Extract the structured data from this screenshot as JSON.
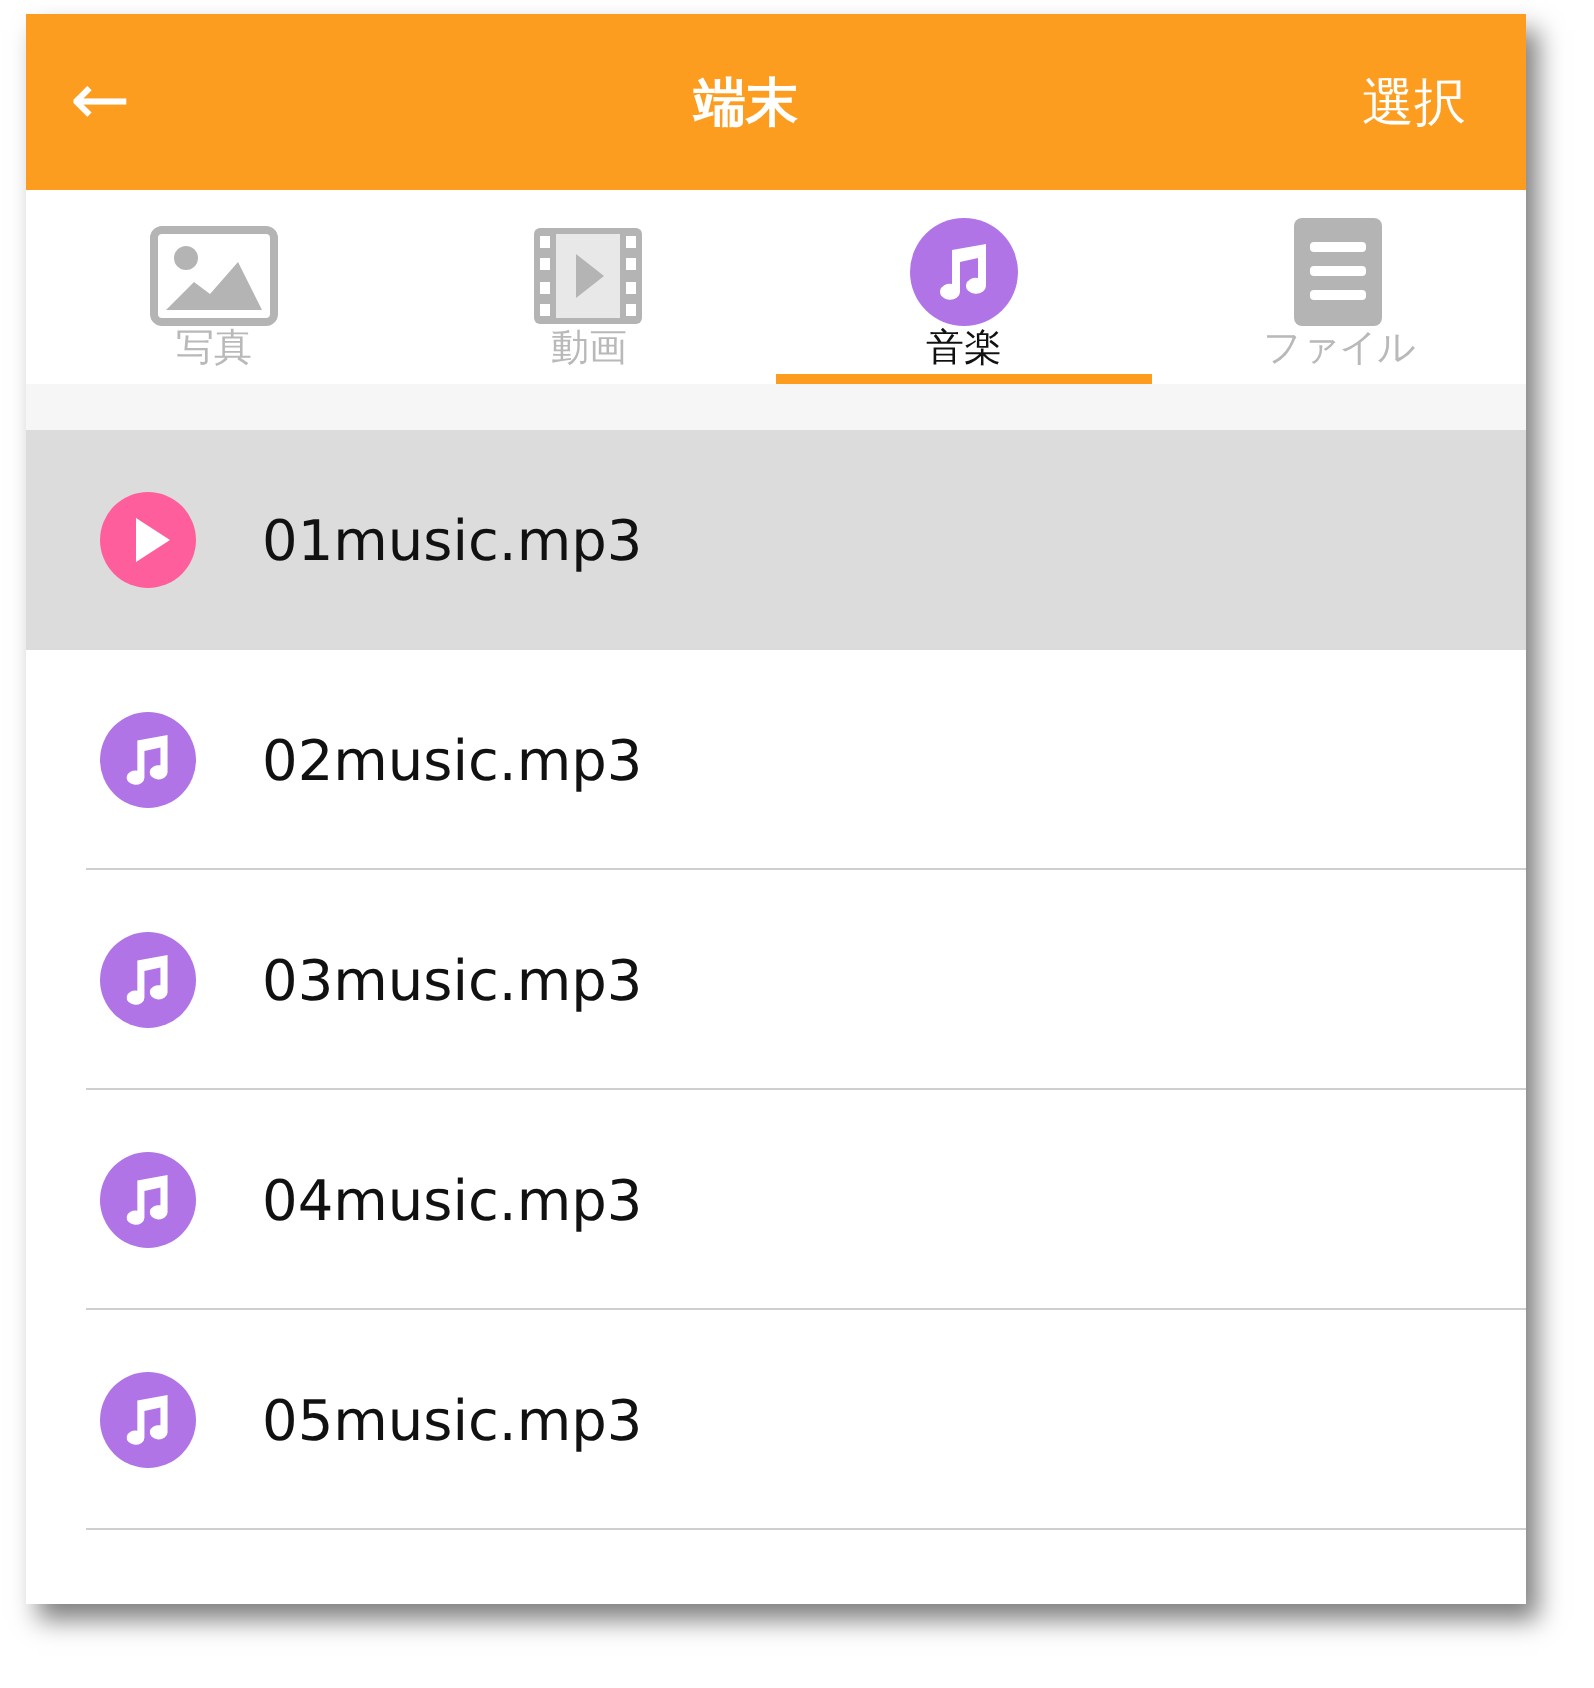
{
  "header": {
    "back_icon": "←",
    "title": "端末",
    "action": "選択"
  },
  "tabs": [
    {
      "kind": "photo",
      "label": "写真",
      "selected": false
    },
    {
      "kind": "video",
      "label": "動画",
      "selected": false
    },
    {
      "kind": "music",
      "label": "音楽",
      "selected": true
    },
    {
      "kind": "file",
      "label": "ファイル",
      "selected": false
    }
  ],
  "files": [
    {
      "name": "01music.mp3",
      "selected": true,
      "playing": true
    },
    {
      "name": "02music.mp3",
      "selected": false,
      "playing": false
    },
    {
      "name": "03music.mp3",
      "selected": false,
      "playing": false
    },
    {
      "name": "04music.mp3",
      "selected": false,
      "playing": false
    },
    {
      "name": "05music.mp3",
      "selected": false,
      "playing": false
    }
  ]
}
